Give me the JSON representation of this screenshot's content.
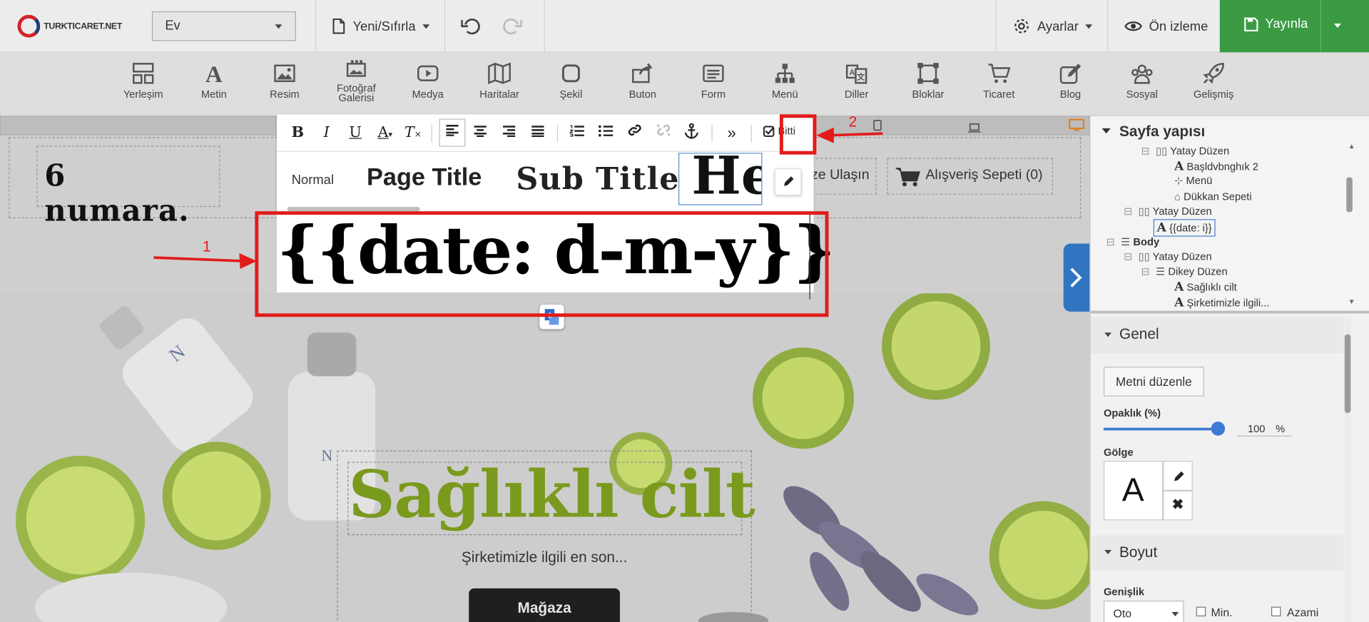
{
  "topbar": {
    "logo_text": "TURKTICARET.NET",
    "page_select": "Ev",
    "new_reset": "Yeni/Sıfırla",
    "settings": "Ayarlar",
    "preview": "Ön izleme",
    "publish": "Yayınla",
    "colors": {
      "publish_bg": "#3a9b43",
      "topbar_bg": "#ececec"
    }
  },
  "elements": [
    {
      "label": "Yerleşim",
      "icon": "layout-icon"
    },
    {
      "label": "Metin",
      "icon": "text-icon"
    },
    {
      "label": "Resim",
      "icon": "image-icon"
    },
    {
      "label": "Fotoğraf\nGalerisi",
      "icon": "gallery-icon"
    },
    {
      "label": "Medya",
      "icon": "media-icon"
    },
    {
      "label": "Haritalar",
      "icon": "map-icon"
    },
    {
      "label": "Şekil",
      "icon": "shape-icon"
    },
    {
      "label": "Buton",
      "icon": "button-icon"
    },
    {
      "label": "Form",
      "icon": "form-icon"
    },
    {
      "label": "Menü",
      "icon": "menu-icon"
    },
    {
      "label": "Diller",
      "icon": "languages-icon"
    },
    {
      "label": "Bloklar",
      "icon": "blocks-icon"
    },
    {
      "label": "Ticaret",
      "icon": "cart-icon"
    },
    {
      "label": "Blog",
      "icon": "blog-icon"
    },
    {
      "label": "Sosyal",
      "icon": "social-icon"
    },
    {
      "label": "Gelişmiş",
      "icon": "rocket-icon"
    }
  ],
  "text_toolbar": {
    "done": "Bitti",
    "styles": [
      "Normal",
      "Page Title",
      "Sub Title",
      "He"
    ]
  },
  "canvas": {
    "logo_text": "6 numara.",
    "contact": "ze Ulaşın",
    "cart": "Alışveriş Sepeti (0)",
    "date_text": "{{date: d-m-y}}",
    "hero_title": "Sağlıklı cilt",
    "hero_subtitle": "Şirketimizle ilgili en son...",
    "hero_button": "Mağaza",
    "colors": {
      "hero_title": "#7a9a1d"
    }
  },
  "annotations": {
    "arrow1": "1",
    "arrow2": "2"
  },
  "sidebar": {
    "structure_title": "Sayfa yapısı",
    "tree": [
      "Yatay Düzen",
      "Başldvbnghık 2",
      "Menü",
      "Dükkan Sepeti",
      "Yatay Düzen",
      "{{date: i}}",
      "Body",
      "Yatay Düzen",
      "Dikey Düzen",
      "Sağlıklı cilt",
      "Şirketimizle ilgili..."
    ],
    "general_title": "Genel",
    "edit_text": "Metni düzenle",
    "opacity_label": "Opaklık (%)",
    "opacity_value": "100",
    "opacity_unit": "%",
    "opacity_percent": 100,
    "shadow_label": "Gölge",
    "shadow_letter": "A",
    "size_title": "Boyut",
    "width_label": "Genişlik",
    "width_value": "Oto",
    "min_label": "Min.",
    "max_label": "Azami"
  }
}
